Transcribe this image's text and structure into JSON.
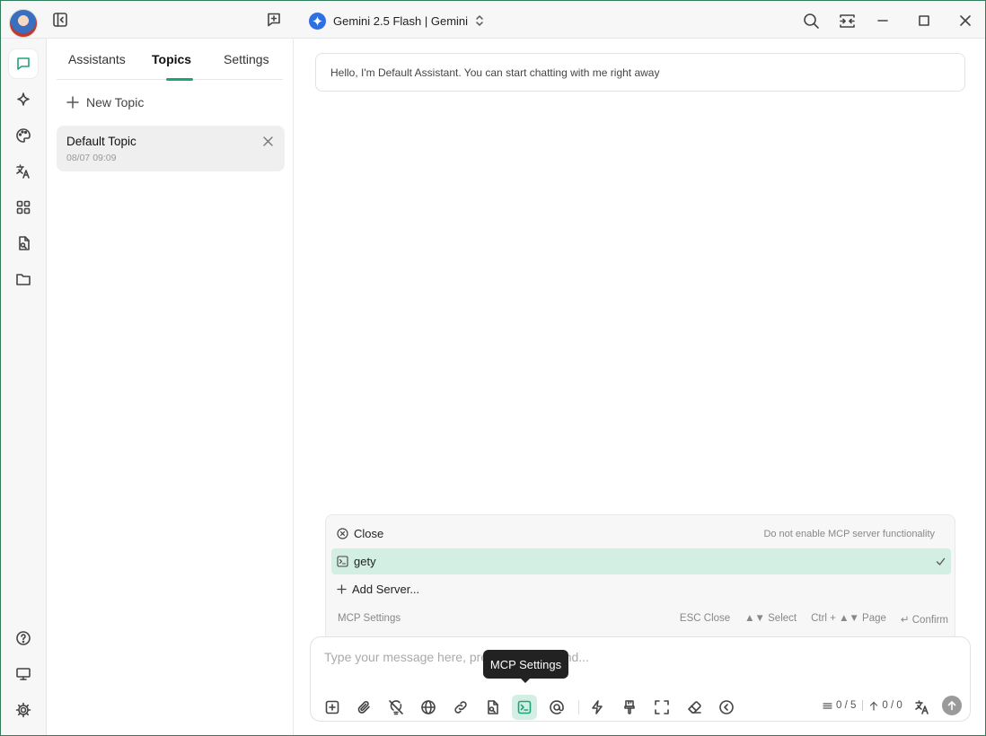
{
  "window": {
    "model_name": "Gemini 2.5 Flash | Gemini"
  },
  "sidebar": {
    "tabs": [
      {
        "label": "Assistants"
      },
      {
        "label": "Topics"
      },
      {
        "label": "Settings"
      }
    ],
    "active_tab": "Topics",
    "new_topic_label": "New Topic",
    "topics": [
      {
        "title": "Default Topic",
        "time": "08/07 09:09"
      }
    ]
  },
  "chat": {
    "greeting": "Hello, I'm Default Assistant. You can start chatting with me right away"
  },
  "mcp_menu": {
    "items": [
      {
        "icon": "circle-x-icon",
        "label": "Close",
        "hint": "Do not enable MCP server functionality"
      },
      {
        "icon": "terminal-icon",
        "label": "gety",
        "selected": true
      },
      {
        "icon": "plus-icon",
        "label": "Add Server..."
      }
    ],
    "footer_title": "MCP Settings",
    "footer_keys": [
      "ESC Close",
      "▲▼ Select",
      "Ctrl + ▲▼ Page",
      "↵ Confirm"
    ]
  },
  "input": {
    "placeholder": "Type your message here, press Enter to send...",
    "token_counter": "0 / 5",
    "upload_counter": "0 / 0"
  },
  "tooltip": {
    "text": "MCP Settings"
  },
  "colors": {
    "accent": "#1fa37a",
    "selected_bg": "#d3eee2",
    "model_icon": "#2f6fe4"
  }
}
